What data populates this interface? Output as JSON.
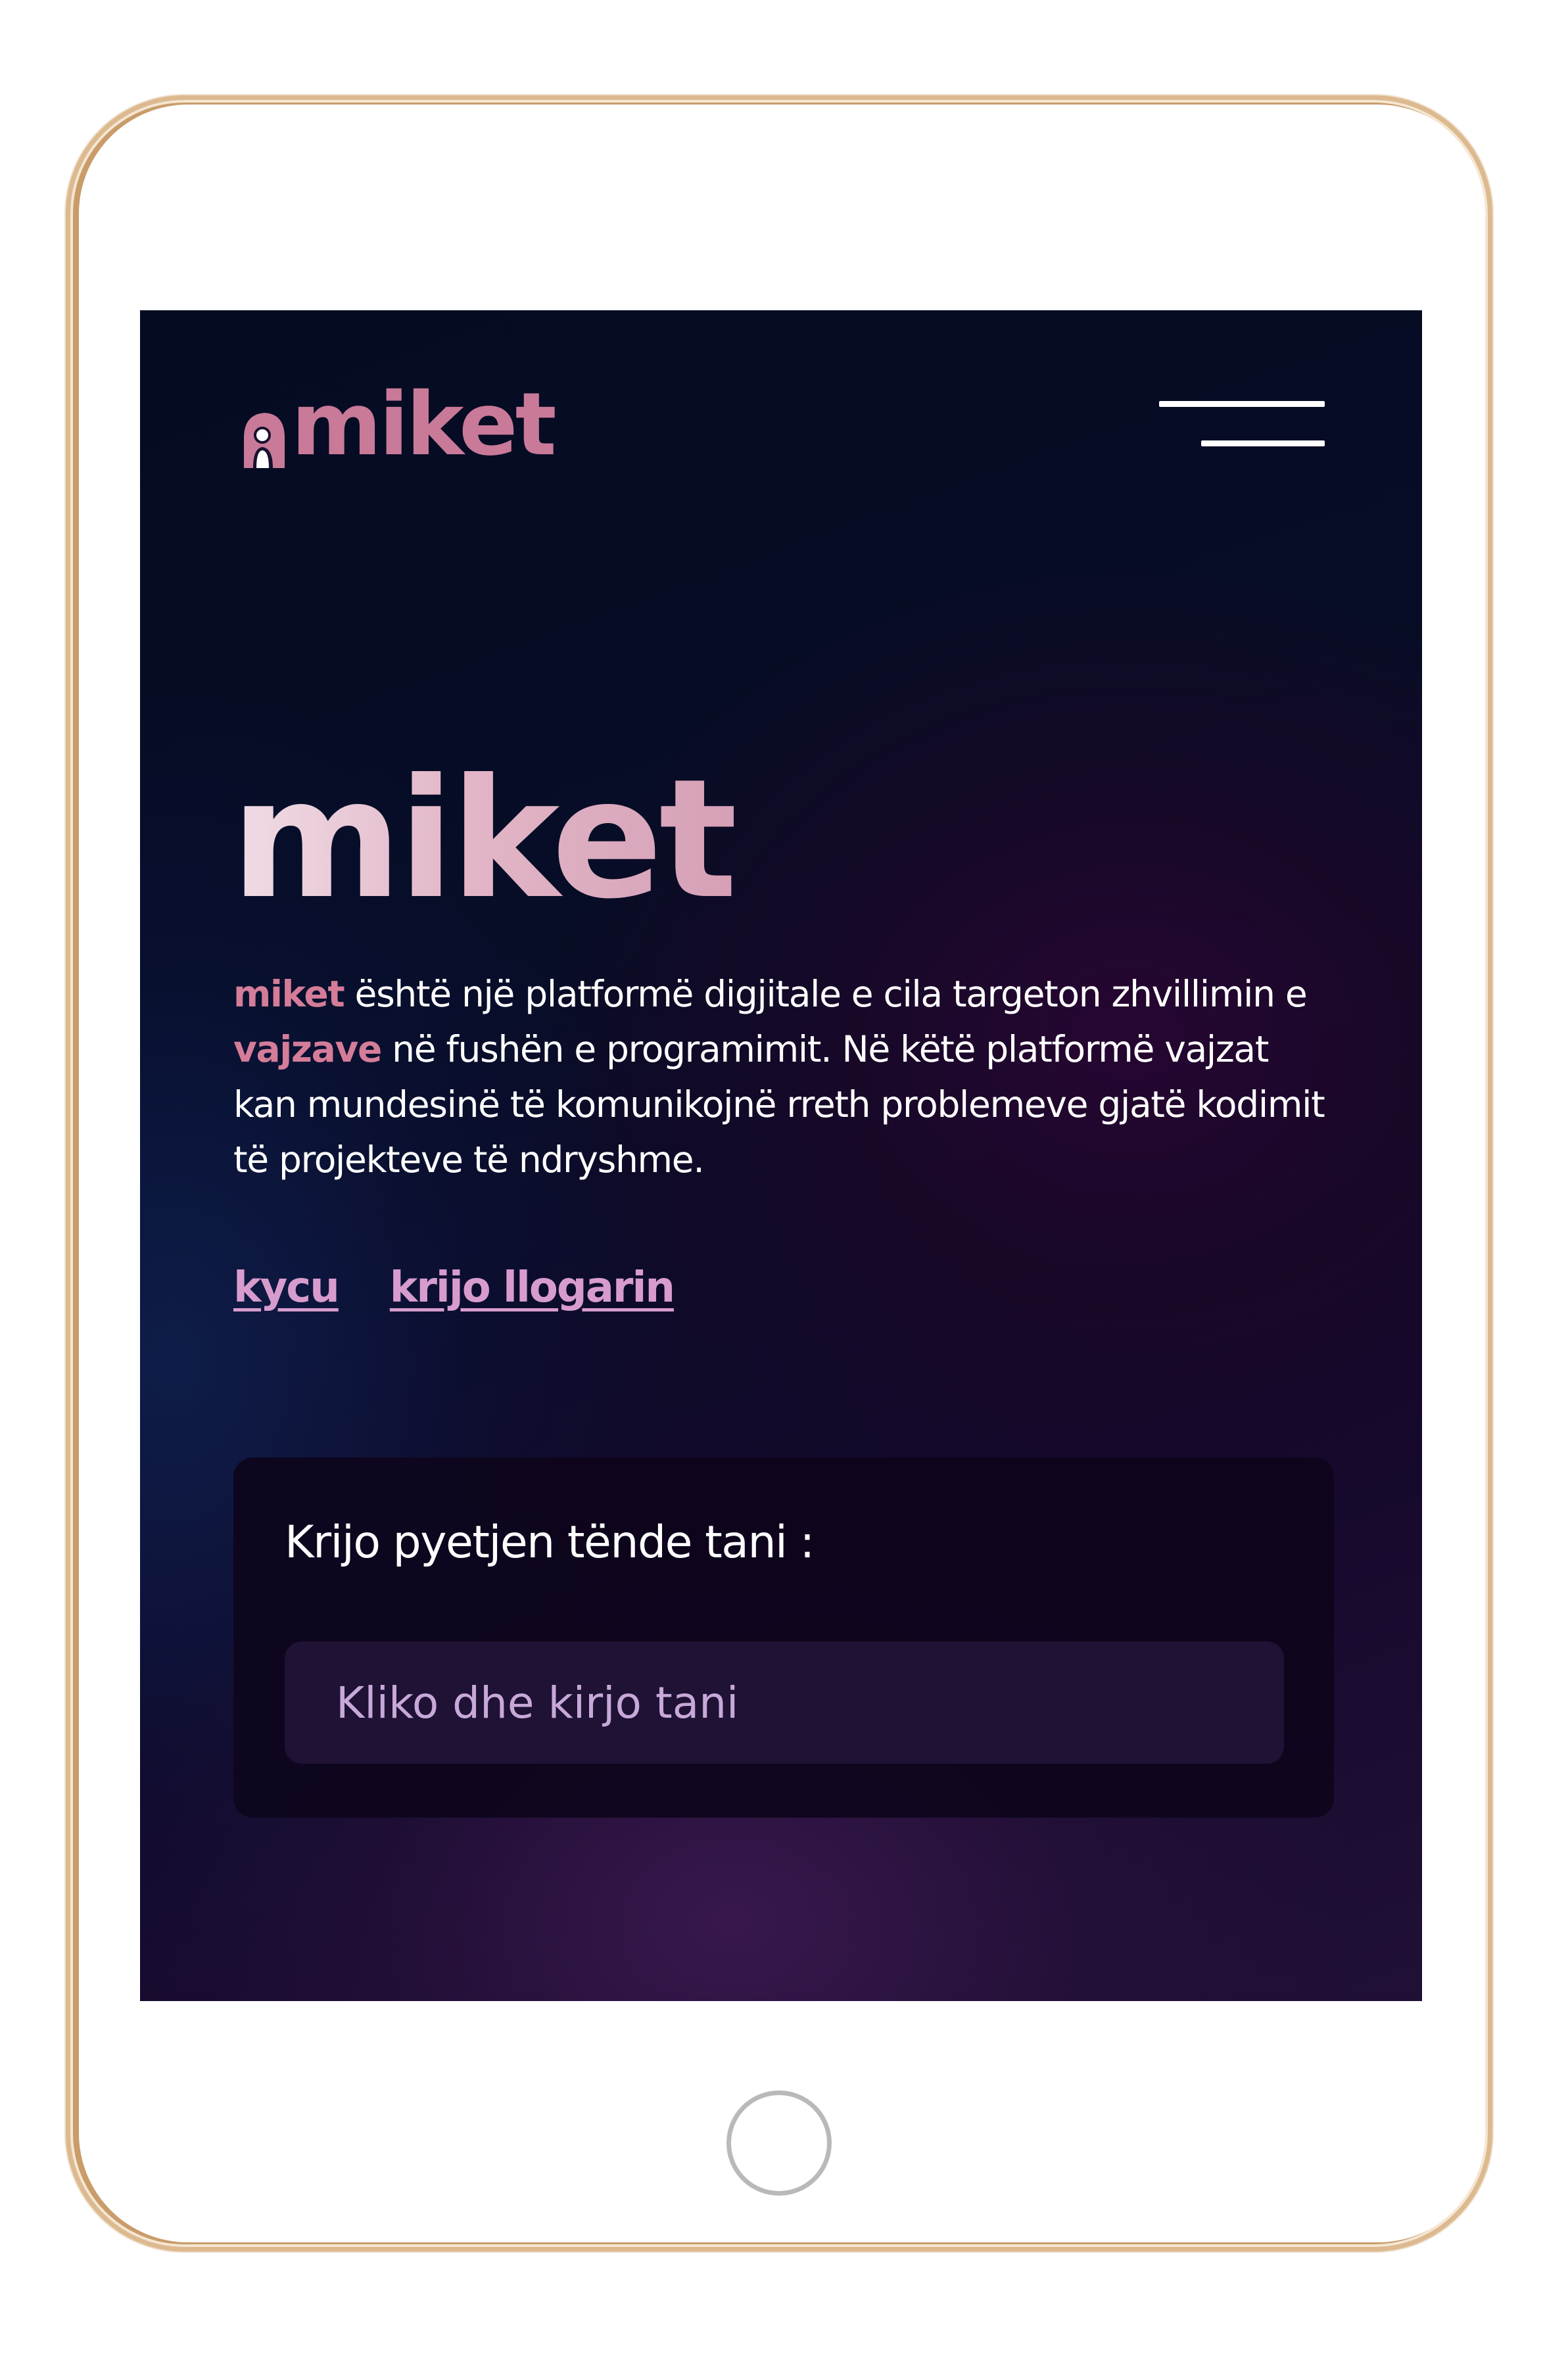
{
  "header": {
    "logo_text": "miket",
    "logo_icon": "girl-silhouette-icon",
    "menu_icon": "hamburger-menu-icon"
  },
  "hero": {
    "title": "miket",
    "description": {
      "highlight_1": "miket",
      "part_1": " është një platformë digjitale e cila targeton zhvillimin e ",
      "highlight_2": "vajzave",
      "part_2": " në fushën e programimit. Në këtë platformë vajzat kan mundesinë të komunikojnë rreth problemeve gjatë kodimit të projekteve të ndryshme."
    },
    "login_link": "kycu",
    "register_link": "krijo llogarin"
  },
  "question_card": {
    "label": "Krijo pyetjen tënde tani :",
    "input_value": "",
    "input_placeholder": "Kliko dhe kirjo tani"
  },
  "colors": {
    "accent_pink": "#d47c98",
    "link_purple": "#d79ccd",
    "background_dark": "#070d26",
    "card_background": "#0e051c",
    "input_background": "#1f1235",
    "frame_gold": "#dcb98f"
  }
}
